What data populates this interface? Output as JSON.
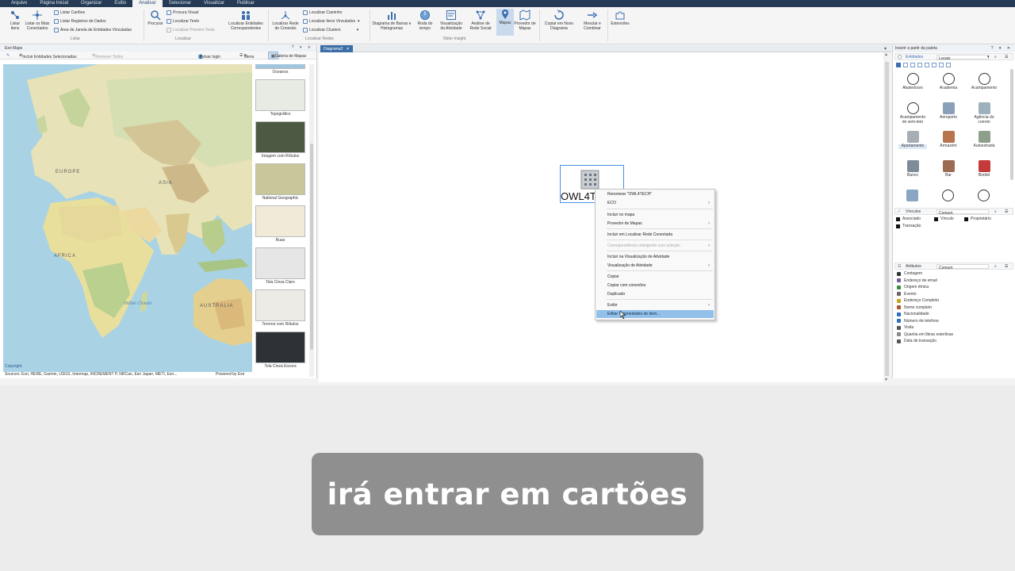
{
  "menubar": {
    "tabs": [
      "Arquivo",
      "Página Inicial",
      "Organizar",
      "Estilo",
      "Analisar",
      "Selecionar",
      "Visualizar",
      "Publicar"
    ],
    "active_tab": "Analisar"
  },
  "ribbon": {
    "listar": {
      "listar_itens": "Listar Itens",
      "listar_conectados": "Listar os Mais Conectados",
      "listar_cartoes": "Listar Cartões",
      "listar_registros": "Listar Registros de Dados",
      "area_janela": "Área de Janela de Entidades Vinculadas",
      "group": "Listar"
    },
    "localizar": {
      "procurar": "Procurar",
      "procura_visual": "Procura Visual",
      "localizar_texto": "Localizar Texto",
      "localizar_proximo": "Localizar Próximo Texto",
      "localizar_entidades": "Localizar Entidades Correspondentes",
      "group": "Localizar"
    },
    "redes": {
      "localizar_rede": "Localizar Rede de Conexão",
      "localizar_caminho": "Localizar Caminho",
      "localizar_itens": "Localizar Itens Vinculados",
      "localizar_clusters": "Localizar Clusters",
      "group": "Localizar Redes"
    },
    "insight": {
      "diagrama_barras": "Diagrama de Barras e Histogramas",
      "roda_tempo": "Roda do tempo",
      "visualizacao_atividade": "Visualização da Atividade",
      "analise_rede": "Análise de Rede Social",
      "mapas": "Mapas",
      "provedor_mapas": "Provedor de Mapas",
      "group": "Obter Insight"
    },
    "copiar_novo": "Copiar em Novo Diagrama",
    "mesclar": "Mesclar e Combinar",
    "extensoes": "Extensões"
  },
  "esri": {
    "title": "Esri Maps",
    "incluir": "Incluir Entidades Selecionadas",
    "remover": "Remover Todos",
    "login": "Efetuar login",
    "menu": "Menu",
    "galeria": "Galeria de Mapas",
    "map_labels": {
      "europe": "EUROPE",
      "asia": "ASIA",
      "africa": "AFRICA",
      "australia": "AUSTRALIA",
      "indian_ocean": "Indian Ocean"
    },
    "copyright": "Copyright",
    "attribution": "Sources: Esri, HERE, Garmin, USGS, Intermap, INCREMENT P, NRCan, Esri Japan, METI, Esri...",
    "powered": "Powered by Esri",
    "gallery": [
      "Oceanos",
      "Topográfico",
      "Imagem com Rótulos",
      "National Geographic",
      "Ruas",
      "Tela Cinza Claro",
      "Terreno com Rótulos",
      "Tela Cinza Escura"
    ],
    "gallery_colors": [
      "#9fc6dd",
      "#e8ebe3",
      "#4c5a44",
      "#c9c79a",
      "#f1ead8",
      "#e6e6e6",
      "#ecebe6",
      "#2e3136"
    ]
  },
  "document": {
    "tab": "Diagrama2",
    "close": "✕"
  },
  "node": {
    "label": "OWL4TECH"
  },
  "context_menu": {
    "items": [
      {
        "label": "Renomear \"OWL4TECH\"",
        "submenu": false,
        "disabled": false
      },
      {
        "label": "ECO",
        "submenu": true,
        "disabled": false
      },
      {
        "label": "Incluir no mapa",
        "submenu": false,
        "disabled": false
      },
      {
        "label": "Provedor de Mapas",
        "submenu": true,
        "disabled": false
      },
      {
        "label": "Incluir em Localizar Rede Conectada",
        "submenu": false,
        "disabled": false
      },
      {
        "label": "Correspondência inteligente com seleção",
        "submenu": true,
        "disabled": true
      },
      {
        "label": "Incluir na Visualização de Atividade",
        "submenu": false,
        "disabled": false
      },
      {
        "label": "Visualização de Atividade",
        "submenu": true,
        "disabled": false
      },
      {
        "label": "Copiar",
        "submenu": false,
        "disabled": false
      },
      {
        "label": "Copiar com conexões",
        "submenu": false,
        "disabled": false
      },
      {
        "label": "Duplicado",
        "submenu": false,
        "disabled": false
      },
      {
        "label": "Exibir",
        "submenu": true,
        "disabled": false
      },
      {
        "label": "Editar Propriedades do item...",
        "submenu": false,
        "disabled": false,
        "highlighted": true
      }
    ]
  },
  "palette": {
    "title": "Inserir a partir da paleta",
    "entidades": "Entidades",
    "locais": "Locais",
    "items": [
      "Abatedouro",
      "Academia",
      "Acampamento",
      "Acampamento de sem-teto",
      "Aeroporto",
      "Agência do correio",
      "Apartamento",
      "Armazém",
      "Autoestrada",
      "Banco",
      "Bar",
      "Bordel"
    ],
    "vinculos_title": "Vínculos",
    "vinculos_filter": "Comum",
    "vinculos": [
      "Associado",
      "Vínculo",
      "Proprietário",
      "Transação"
    ],
    "atributos_title": "Atributos",
    "atributos_filter": "Comum",
    "atributos": [
      "Contagem",
      "Endereço de email",
      "Origem étnica",
      "Evento",
      "Endereço Completo",
      "Nome completo",
      "Nacionalidade",
      "Número de telefone",
      "Visita",
      "Quantia em libras esterlinas",
      "Data de transação"
    ],
    "attr_colors": [
      "#333333",
      "#7a5a9a",
      "#3d8b3d",
      "#666666",
      "#c7a21b",
      "#a8562b",
      "#2a6fbf",
      "#2a6fbf",
      "#555555",
      "#888888",
      "#555555"
    ]
  },
  "caption": {
    "text": "irá entrar em cartões"
  }
}
